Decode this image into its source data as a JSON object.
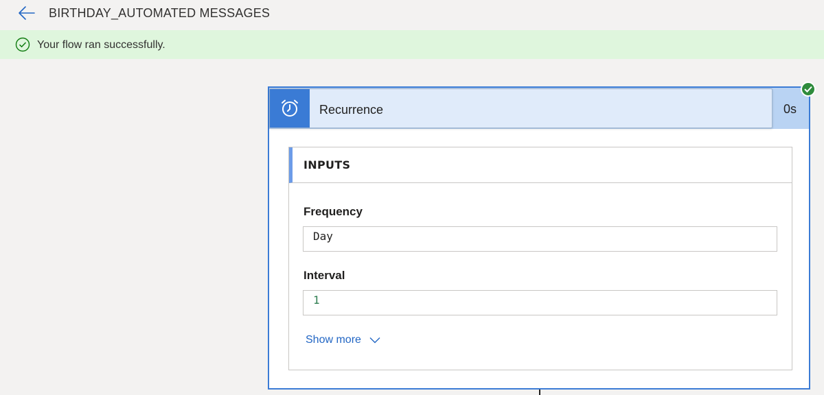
{
  "header": {
    "back_icon": "arrow-left-icon",
    "title": "BIRTHDAY_AUTOMATED MESSAGES"
  },
  "banner": {
    "icon": "check-circle-icon",
    "message": "Your flow ran successfully.",
    "color": "#dff6dd"
  },
  "trigger": {
    "icon": "alarm-clock-icon",
    "title": "Recurrence",
    "duration": "0s",
    "status_icon": "check-badge-icon",
    "accent": "#3a7bd5"
  },
  "inputs": {
    "heading": "INPUTS",
    "frequency": {
      "label": "Frequency",
      "value": "Day"
    },
    "interval": {
      "label": "Interval",
      "value": "1"
    },
    "show_more": "Show more",
    "show_more_icon": "chevron-down-icon"
  }
}
